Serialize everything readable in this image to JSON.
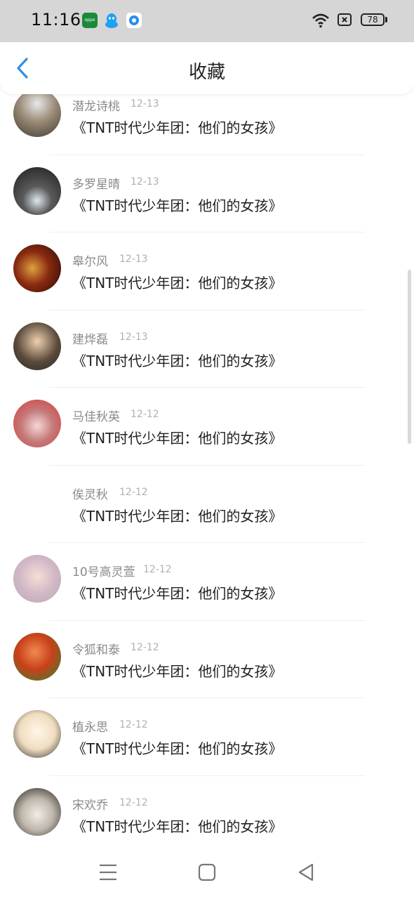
{
  "status_bar": {
    "time": "11:16",
    "battery": "78",
    "icons": [
      "oppo-app-icon",
      "qq-icon",
      "browser-icon",
      "wifi-icon",
      "sim-icon",
      "battery-icon"
    ]
  },
  "header": {
    "title": "收藏",
    "back_icon": "chevron-left-icon",
    "accent": "#2f8fe6"
  },
  "items": [
    {
      "name": "潜龙诗桃",
      "date": "12-13",
      "title": "《TNT时代少年团：他们的女孩》"
    },
    {
      "name": "多罗星晴",
      "date": "12-13",
      "title": "《TNT时代少年团：他们的女孩》"
    },
    {
      "name": "皋尔风",
      "date": "12-13",
      "title": "《TNT时代少年团：他们的女孩》"
    },
    {
      "name": "建烨磊",
      "date": "12-13",
      "title": "《TNT时代少年团：他们的女孩》"
    },
    {
      "name": "马佳秋英",
      "date": "12-12",
      "title": "《TNT时代少年团：他们的女孩》"
    },
    {
      "name": "俟灵秋",
      "date": "12-12",
      "title": "《TNT时代少年团：他们的女孩》"
    },
    {
      "name": "10号高灵萱",
      "date": "12-12",
      "title": "《TNT时代少年团：他们的女孩》"
    },
    {
      "name": "令狐和泰",
      "date": "12-12",
      "title": "《TNT时代少年团：他们的女孩》"
    },
    {
      "name": "植永思",
      "date": "12-12",
      "title": "《TNT时代少年团：他们的女孩》"
    },
    {
      "name": "宋欢乔",
      "date": "12-12",
      "title": "《TNT时代少年团：他们的女孩》"
    }
  ],
  "nav": {
    "icons": [
      "menu-icon",
      "home-square-icon",
      "back-triangle-icon"
    ]
  }
}
